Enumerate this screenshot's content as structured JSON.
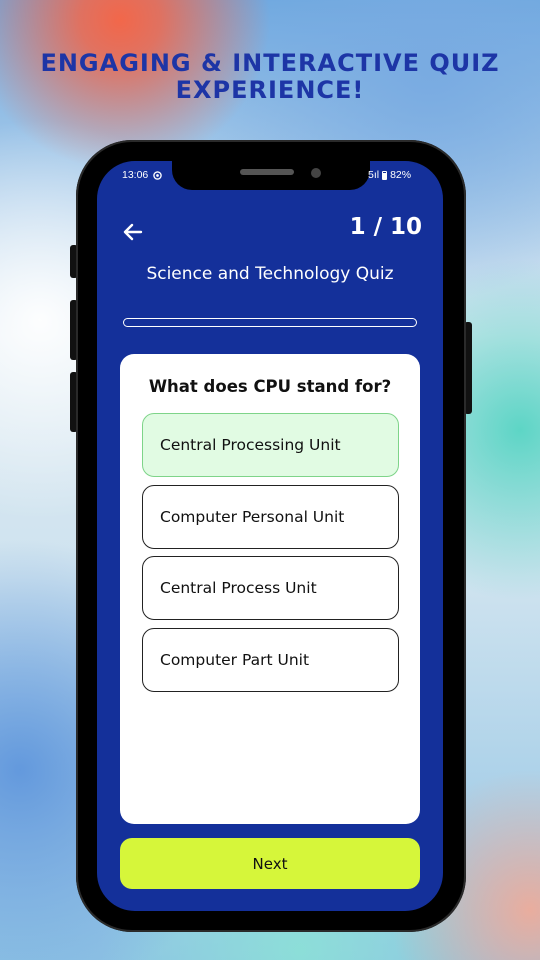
{
  "promo": {
    "headline_line1": "ENGAGING & INTERACTIVE QUIZ",
    "headline_line2": "EXPERIENCE!"
  },
  "status_bar": {
    "time": "13:06",
    "battery": "82%",
    "signal": "5ıl"
  },
  "quiz": {
    "counter": "1 / 10",
    "title": "Science and Technology Quiz",
    "progress": 0.1,
    "question": "What does CPU stand for?",
    "options": [
      {
        "label": "Central Processing Unit",
        "selected": true
      },
      {
        "label": "Computer Personal Unit",
        "selected": false
      },
      {
        "label": "Central Process Unit",
        "selected": false
      },
      {
        "label": "Computer Part Unit",
        "selected": false
      }
    ],
    "next_label": "Next"
  },
  "colors": {
    "headline": "#1d35a6",
    "screen_bg": "#14309a",
    "selected_option_bg": "#e1fbe3",
    "selected_option_border": "#7ed489",
    "next_button": "#d6f63a"
  },
  "icons": {
    "back": "arrow-left-icon",
    "status": "notification-icon"
  }
}
